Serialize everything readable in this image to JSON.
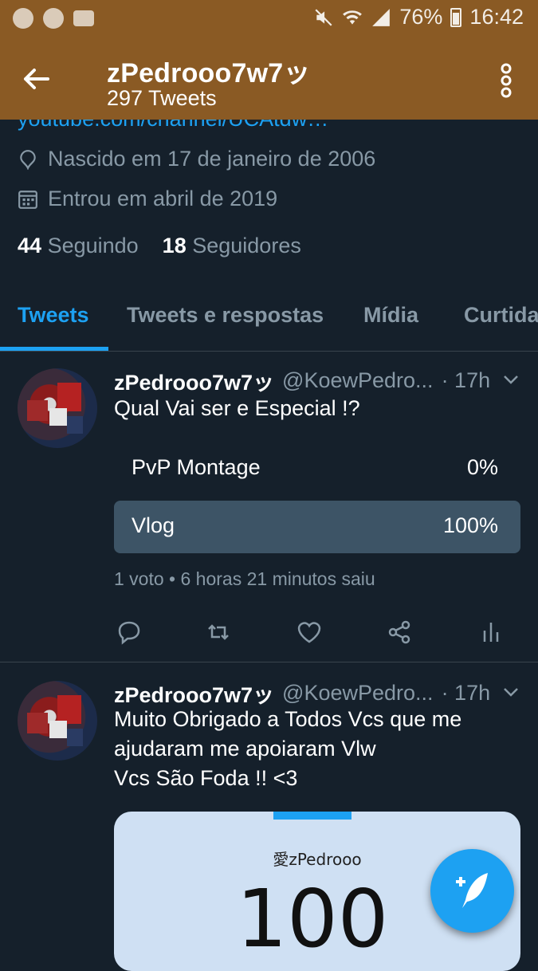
{
  "status_bar": {
    "battery": "76%",
    "time": "16:42"
  },
  "header": {
    "title": "zPedrooo7w7ッ",
    "subtitle": "297 Tweets"
  },
  "profile": {
    "link": "youtube.com/channel/UCAtdw…",
    "birth": "Nascido em 17 de janeiro de 2006",
    "joined": "Entrou em abril de 2019",
    "following_count": "44",
    "following_label": "Seguindo",
    "followers_count": "18",
    "followers_label": "Seguidores"
  },
  "tabs": [
    "Tweets",
    "Tweets e respostas",
    "Mídia",
    "Curtidas"
  ],
  "tweets": [
    {
      "name": "zPedrooo7w7ッ",
      "handle": "@KoewPedro...",
      "time": "· 17h",
      "text": "Qual Vai ser e Especial !?",
      "poll": {
        "options": [
          {
            "label": "PvP Montage",
            "percent": "0%"
          },
          {
            "label": "Vlog",
            "percent": "100%"
          }
        ],
        "meta": "1 voto • 6 horas 21 minutos saiu"
      }
    },
    {
      "name": "zPedrooo7w7ッ",
      "handle": "@KoewPedro...",
      "time": "· 17h",
      "text_lines": [
        "Muito Obrigado a Todos Vcs que me",
        "ajudaram me apoiaram Vlw",
        "Vcs São Foda !! <3"
      ],
      "media": {
        "name": "愛zPedrooo",
        "number": "100"
      }
    }
  ],
  "colors": {
    "header_bg": "#8a5a24",
    "background": "#15202b",
    "accent": "#1da1f2",
    "muted": "#8899a6"
  },
  "icons": [
    "chrome-icon",
    "whatsapp-icon",
    "voicemail-icon",
    "mute-icon",
    "wifi-icon",
    "signal-icon",
    "battery-icon",
    "back-arrow-icon",
    "more-vert-icon",
    "location-icon",
    "calendar-icon",
    "chevron-down-icon",
    "reply-icon",
    "retweet-icon",
    "like-icon",
    "share-icon",
    "analytics-icon",
    "compose-tweet-icon"
  ]
}
